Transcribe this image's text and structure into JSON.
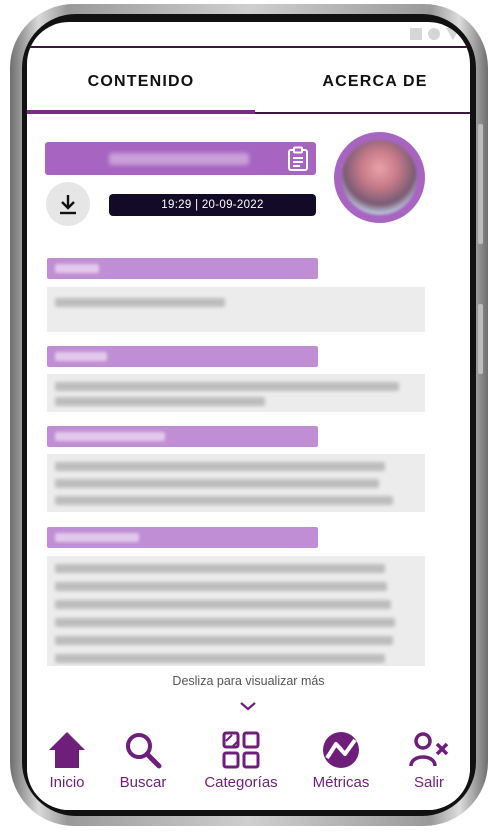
{
  "tabs": [
    {
      "label": "CONTENIDO",
      "active": true
    },
    {
      "label": "ACERCA DE",
      "active": false
    }
  ],
  "header": {
    "datetime": "19:29  |  20-09-2022"
  },
  "scroll_hint": "Desliza para visualizar más",
  "bottom_nav": [
    {
      "label": "Inicio",
      "icon": "home-icon"
    },
    {
      "label": "Buscar",
      "icon": "search-icon"
    },
    {
      "label": "Categorías",
      "icon": "categories-icon"
    },
    {
      "label": "Métricas",
      "icon": "metrics-icon"
    },
    {
      "label": "Salir",
      "icon": "logout-icon"
    }
  ],
  "colors": {
    "brand": "#6d1f7a",
    "accent": "#a765c1",
    "section_title": "#bf8ed4",
    "date_pill": "#120a26"
  }
}
